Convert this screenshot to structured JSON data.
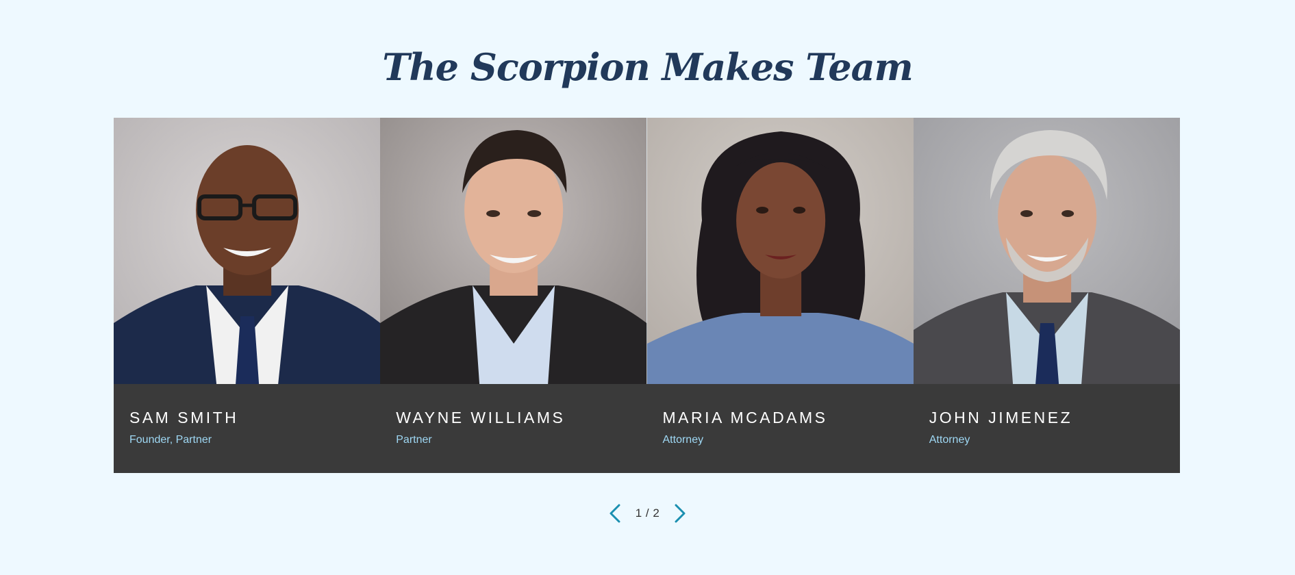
{
  "section": {
    "title": "The Scorpion Makes Team"
  },
  "team": {
    "members": [
      {
        "name": "SAM SMITH",
        "role": "Founder, Partner"
      },
      {
        "name": "WAYNE WILLIAMS",
        "role": "Partner"
      },
      {
        "name": "MARIA MCADAMS",
        "role": "Attorney"
      },
      {
        "name": "JOHN JIMENEZ",
        "role": "Attorney"
      }
    ]
  },
  "pagination": {
    "current": "1 / 2",
    "prev_icon": "chevron-left-icon",
    "next_icon": "chevron-right-icon"
  },
  "colors": {
    "background": "#eef9ff",
    "title": "#21395a",
    "card_info_bg": "#3a3a3a",
    "role_text": "#9fd8f4",
    "accent_arrow": "#1a8fb0"
  }
}
